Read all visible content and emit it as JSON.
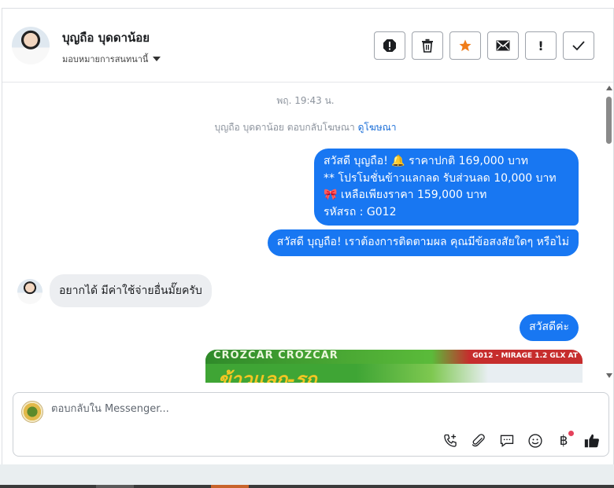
{
  "header": {
    "contact_name": "บุญถือ บุดดาน้อย",
    "assign_label": "มอบหมายการสนทนานี้",
    "actions": [
      {
        "name": "report-icon"
      },
      {
        "name": "trash-icon"
      },
      {
        "name": "star-icon",
        "color": "#f07d1a"
      },
      {
        "name": "envelope-icon"
      },
      {
        "name": "exclamation-icon",
        "text": "!"
      },
      {
        "name": "check-icon"
      }
    ]
  },
  "conversation": {
    "timestamp": "พฤ. 19:43 น.",
    "ad_reply_text": "บุญถือ บุดดาน้อย ตอบกลับโฆษณา",
    "ad_link": "ดูโฆษณา",
    "messages": [
      {
        "direction": "outgoing",
        "lines": [
          "สวัสดี บุญถือ! 🔔 ราคาปกติ 169,000 บาท",
          "** โปรโมชั่นข้าวแลกลด รับส่วนลด 10,000 บาท",
          "🎀  เหลือเพียงราคา 159,000 บาท",
          " รหัสรถ : G012"
        ]
      },
      {
        "direction": "outgoing",
        "text": "สวัสดี บุญถือ! เราต้องการติดตามผล คุณมีข้อสงสัยใดๆ หรือไม่"
      },
      {
        "direction": "incoming",
        "text": "อยากได้ มีค่าใช้จ่ายอื่นมั๊ยครับ"
      },
      {
        "direction": "outgoing",
        "text": "สวัสดีค่ะ"
      }
    ],
    "promo_image": {
      "brand": "CROZCAR CROZCAR",
      "code": "G012 - MIRAGE 1.2 GLX AT",
      "headline": "ข้าวแลก-รถ"
    }
  },
  "composer": {
    "placeholder": "ตอบกลับใน Messenger...",
    "tools": [
      "phone-add-icon",
      "paperclip-icon",
      "saved-reply-icon",
      "emoji-icon",
      "baht-icon",
      "thumbs-up-icon"
    ]
  },
  "colors": {
    "outgoing_bubble": "#1877f2",
    "incoming_bubble": "#eceef1",
    "link": "#1a6ed8"
  }
}
